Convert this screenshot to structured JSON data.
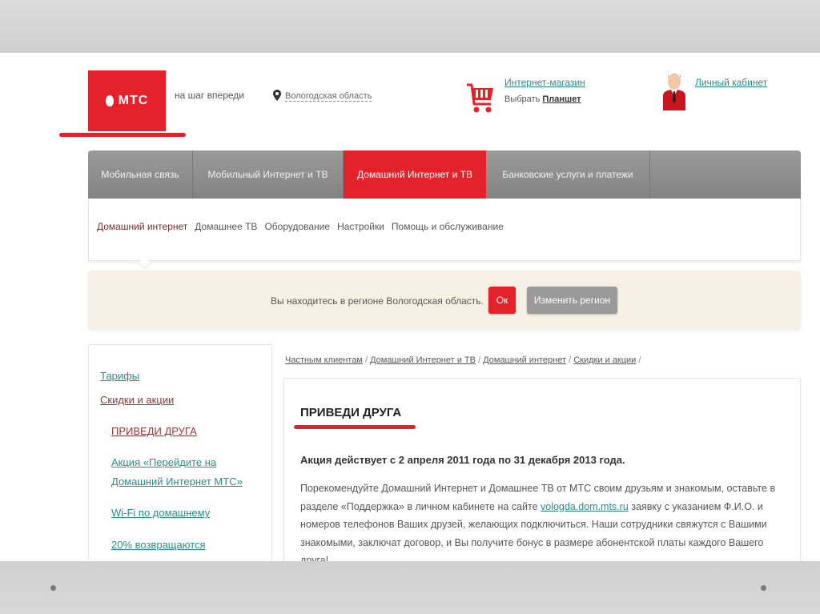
{
  "header": {
    "logo_text": "МТС",
    "slogan": "на шаг впереди",
    "region": "Вологодская область",
    "shop_link": "Интернет-магазин",
    "shop_choose_prefix": "Выбрать",
    "shop_choose_item": "Планшет",
    "cabinet_link": "Личный кабинет"
  },
  "nav": {
    "tabs": [
      {
        "label": "Мобильная связь"
      },
      {
        "label": "Мобильный Интернет и ТВ"
      },
      {
        "label": "Домашний Интернет и ТВ"
      },
      {
        "label": "Банковские услуги и платежи"
      }
    ],
    "subtabs": [
      {
        "label": "Домашний интернет"
      },
      {
        "label": "Домашнее ТВ"
      },
      {
        "label": "Оборудование"
      },
      {
        "label": "Настройки"
      },
      {
        "label": "Помощь и обслуживание"
      }
    ]
  },
  "region_bar": {
    "text": "Вы находитесь в регионе Вологодская область.",
    "ok_label": "Ок",
    "change_label": "Изменить регион"
  },
  "sidebar": {
    "items": [
      {
        "label": "Тарифы"
      },
      {
        "label": "Скидки и акции"
      },
      {
        "label": "ПРИВЕДИ ДРУГА"
      },
      {
        "label": "Акция «Перейдите на"
      },
      {
        "label": "Домашний Интернет МТС»"
      },
      {
        "label": "Wi-Fi по домашнему"
      },
      {
        "label": "20% возвращаются"
      }
    ]
  },
  "breadcrumb": {
    "items": [
      "Частным клиентам",
      "Домашний Интернет и ТВ",
      "Домашний интернет",
      "Скидки и акции"
    ],
    "separator": "/"
  },
  "content": {
    "title": "ПРИВЕДИ ДРУГА",
    "dates": "Акция действует с 2 апреля 2011 года по 31 декабря 2013 года.",
    "text_before": "Порекомендуйте Домашний Интернет и Домашнее ТВ от МТС своим друзьям и знакомым, оставьте в разделе «Поддержка» в личном кабинете на сайте",
    "site": "vologda.dom.mts.ru",
    "text_after": "заявку с указанием Ф.И.О. и номеров телефонов Ваших друзей, желающих подключиться. Наши сотрудники свяжутся с Вашими знакомыми, заключат договор, и Вы получите бонус в размере абонентской платы каждого Вашего друга!"
  },
  "colors": {
    "brand_red": "#e3222b",
    "link_teal": "#2c8a8a",
    "nav_gray": "#8e8e8e",
    "region_bg": "#f6f1e4"
  }
}
